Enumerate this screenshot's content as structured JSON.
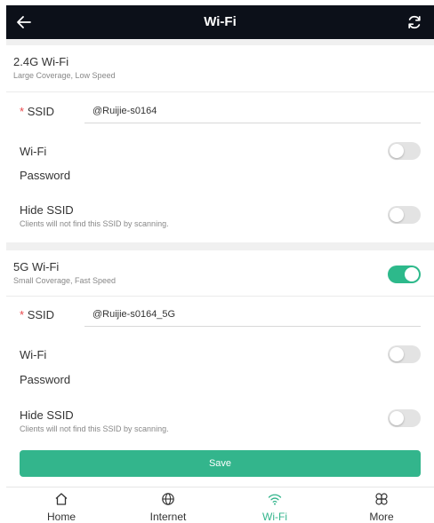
{
  "header": {
    "title": "Wi-Fi"
  },
  "band24": {
    "title": "2.4G Wi-Fi",
    "subtitle": "Large Coverage, Low Speed",
    "ssid_label": "SSID",
    "ssid_required_mark": "*",
    "ssid_value": "@Ruijie-s0164",
    "wifi_password_label_1": "Wi-Fi",
    "wifi_password_label_2": "Password",
    "wifi_password_enabled": false,
    "hide_ssid_label": "Hide SSID",
    "hide_ssid_hint": "Clients will not find this SSID by scanning.",
    "hide_ssid_enabled": false
  },
  "band5": {
    "title": "5G Wi-Fi",
    "subtitle": "Small Coverage, Fast Speed",
    "enabled": true,
    "ssid_label": "SSID",
    "ssid_required_mark": "*",
    "ssid_value": "@Ruijie-s0164_5G",
    "wifi_password_label_1": "Wi-Fi",
    "wifi_password_label_2": "Password",
    "wifi_password_enabled": false,
    "hide_ssid_label": "Hide SSID",
    "hide_ssid_hint": "Clients will not find this SSID by scanning.",
    "hide_ssid_enabled": false
  },
  "save_label": "Save",
  "tabs": [
    {
      "label": "Home",
      "icon": "home-icon"
    },
    {
      "label": "Internet",
      "icon": "globe-icon"
    },
    {
      "label": "Wi-Fi",
      "icon": "wifi-icon",
      "active": true
    },
    {
      "label": "More",
      "icon": "more-icon"
    }
  ],
  "colors": {
    "header_bg": "#0c1019",
    "accent": "#33b58c",
    "toggle_off": "#e3e3e3",
    "section_gap": "#f0f0f0"
  }
}
